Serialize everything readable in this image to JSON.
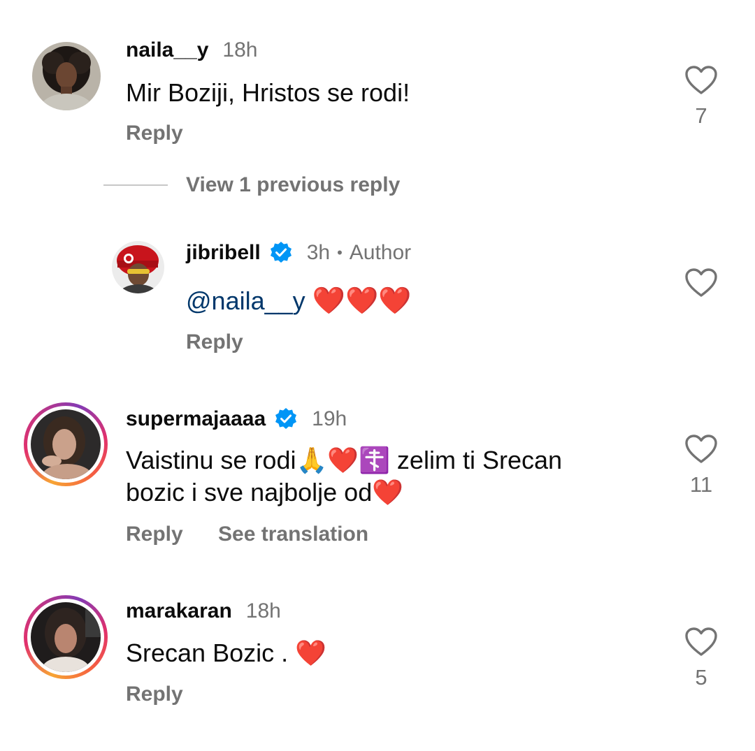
{
  "comments": [
    {
      "username": "naila__y",
      "time": "18h",
      "text": "Mir Boziji, Hristos se rodi!",
      "reply_label": "Reply",
      "like_count": "7",
      "avatar": "woman-curly-hair-avatar"
    },
    {
      "username": "jibribell",
      "time": "3h",
      "author_label": "Author",
      "mention": "@naila__y",
      "text_emojis": "❤️❤️❤️",
      "reply_label": "Reply",
      "like_count": "",
      "avatar": "man-red-hat-avatar",
      "verified": true
    },
    {
      "username": "supermajaaaa",
      "time": "19h",
      "text_line1": "Vaistinu se rodi🙏❤️☦️ zelim ti Srecan",
      "text_line2": "bozic i sve najbolje od❤️",
      "reply_label": "Reply",
      "translate_label": "See translation",
      "like_count": "11",
      "avatar": "woman-dark-hair-avatar",
      "verified": true,
      "story_ring": true
    },
    {
      "username": "marakaran",
      "time": "18h",
      "text": "Srecan Bozic . ❤️",
      "reply_label": "Reply",
      "like_count": "5",
      "avatar": "woman-car-selfie-avatar",
      "story_ring": true
    }
  ],
  "view_replies_label": "View 1 previous reply",
  "colors": {
    "secondary_text": "#737373",
    "mention": "#00376b",
    "verified_blue": "#0095f6",
    "heart_red": "#e8202a"
  }
}
